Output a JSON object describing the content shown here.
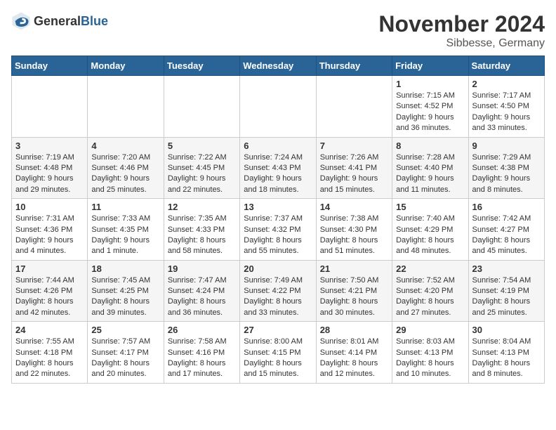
{
  "logo": {
    "text_general": "General",
    "text_blue": "Blue"
  },
  "header": {
    "month": "November 2024",
    "location": "Sibbesse, Germany"
  },
  "days_of_week": [
    "Sunday",
    "Monday",
    "Tuesday",
    "Wednesday",
    "Thursday",
    "Friday",
    "Saturday"
  ],
  "weeks": [
    [
      {
        "day": "",
        "info": ""
      },
      {
        "day": "",
        "info": ""
      },
      {
        "day": "",
        "info": ""
      },
      {
        "day": "",
        "info": ""
      },
      {
        "day": "",
        "info": ""
      },
      {
        "day": "1",
        "info": "Sunrise: 7:15 AM\nSunset: 4:52 PM\nDaylight: 9 hours and 36 minutes."
      },
      {
        "day": "2",
        "info": "Sunrise: 7:17 AM\nSunset: 4:50 PM\nDaylight: 9 hours and 33 minutes."
      }
    ],
    [
      {
        "day": "3",
        "info": "Sunrise: 7:19 AM\nSunset: 4:48 PM\nDaylight: 9 hours and 29 minutes."
      },
      {
        "day": "4",
        "info": "Sunrise: 7:20 AM\nSunset: 4:46 PM\nDaylight: 9 hours and 25 minutes."
      },
      {
        "day": "5",
        "info": "Sunrise: 7:22 AM\nSunset: 4:45 PM\nDaylight: 9 hours and 22 minutes."
      },
      {
        "day": "6",
        "info": "Sunrise: 7:24 AM\nSunset: 4:43 PM\nDaylight: 9 hours and 18 minutes."
      },
      {
        "day": "7",
        "info": "Sunrise: 7:26 AM\nSunset: 4:41 PM\nDaylight: 9 hours and 15 minutes."
      },
      {
        "day": "8",
        "info": "Sunrise: 7:28 AM\nSunset: 4:40 PM\nDaylight: 9 hours and 11 minutes."
      },
      {
        "day": "9",
        "info": "Sunrise: 7:29 AM\nSunset: 4:38 PM\nDaylight: 9 hours and 8 minutes."
      }
    ],
    [
      {
        "day": "10",
        "info": "Sunrise: 7:31 AM\nSunset: 4:36 PM\nDaylight: 9 hours and 4 minutes."
      },
      {
        "day": "11",
        "info": "Sunrise: 7:33 AM\nSunset: 4:35 PM\nDaylight: 9 hours and 1 minute."
      },
      {
        "day": "12",
        "info": "Sunrise: 7:35 AM\nSunset: 4:33 PM\nDaylight: 8 hours and 58 minutes."
      },
      {
        "day": "13",
        "info": "Sunrise: 7:37 AM\nSunset: 4:32 PM\nDaylight: 8 hours and 55 minutes."
      },
      {
        "day": "14",
        "info": "Sunrise: 7:38 AM\nSunset: 4:30 PM\nDaylight: 8 hours and 51 minutes."
      },
      {
        "day": "15",
        "info": "Sunrise: 7:40 AM\nSunset: 4:29 PM\nDaylight: 8 hours and 48 minutes."
      },
      {
        "day": "16",
        "info": "Sunrise: 7:42 AM\nSunset: 4:27 PM\nDaylight: 8 hours and 45 minutes."
      }
    ],
    [
      {
        "day": "17",
        "info": "Sunrise: 7:44 AM\nSunset: 4:26 PM\nDaylight: 8 hours and 42 minutes."
      },
      {
        "day": "18",
        "info": "Sunrise: 7:45 AM\nSunset: 4:25 PM\nDaylight: 8 hours and 39 minutes."
      },
      {
        "day": "19",
        "info": "Sunrise: 7:47 AM\nSunset: 4:24 PM\nDaylight: 8 hours and 36 minutes."
      },
      {
        "day": "20",
        "info": "Sunrise: 7:49 AM\nSunset: 4:22 PM\nDaylight: 8 hours and 33 minutes."
      },
      {
        "day": "21",
        "info": "Sunrise: 7:50 AM\nSunset: 4:21 PM\nDaylight: 8 hours and 30 minutes."
      },
      {
        "day": "22",
        "info": "Sunrise: 7:52 AM\nSunset: 4:20 PM\nDaylight: 8 hours and 27 minutes."
      },
      {
        "day": "23",
        "info": "Sunrise: 7:54 AM\nSunset: 4:19 PM\nDaylight: 8 hours and 25 minutes."
      }
    ],
    [
      {
        "day": "24",
        "info": "Sunrise: 7:55 AM\nSunset: 4:18 PM\nDaylight: 8 hours and 22 minutes."
      },
      {
        "day": "25",
        "info": "Sunrise: 7:57 AM\nSunset: 4:17 PM\nDaylight: 8 hours and 20 minutes."
      },
      {
        "day": "26",
        "info": "Sunrise: 7:58 AM\nSunset: 4:16 PM\nDaylight: 8 hours and 17 minutes."
      },
      {
        "day": "27",
        "info": "Sunrise: 8:00 AM\nSunset: 4:15 PM\nDaylight: 8 hours and 15 minutes."
      },
      {
        "day": "28",
        "info": "Sunrise: 8:01 AM\nSunset: 4:14 PM\nDaylight: 8 hours and 12 minutes."
      },
      {
        "day": "29",
        "info": "Sunrise: 8:03 AM\nSunset: 4:13 PM\nDaylight: 8 hours and 10 minutes."
      },
      {
        "day": "30",
        "info": "Sunrise: 8:04 AM\nSunset: 4:13 PM\nDaylight: 8 hours and 8 minutes."
      }
    ]
  ]
}
